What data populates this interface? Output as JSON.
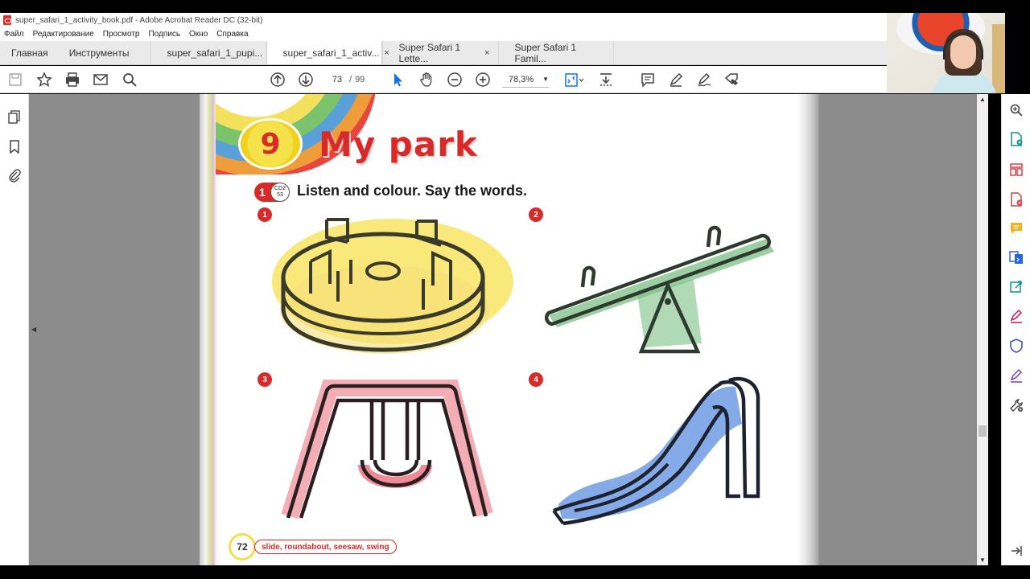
{
  "window": {
    "title": "super_safari_1_activity_book.pdf - Adobe Acrobat Reader DC (32-bit)"
  },
  "menu": [
    "Файл",
    "Редактирование",
    "Просмотр",
    "Подпись",
    "Окно",
    "Справка"
  ],
  "tabs": {
    "home": "Главная",
    "tools": "Инструменты",
    "documents": [
      {
        "label": "super_safari_1_pupi...",
        "active": false,
        "closable": false
      },
      {
        "label": "super_safari_1_activ...",
        "active": true,
        "closable": true
      },
      {
        "label": "Super Safari 1 Lette...",
        "active": false,
        "closable": true
      },
      {
        "label": "Super Safari 1 Famil...",
        "active": false,
        "closable": false
      }
    ],
    "close_glyph": "×"
  },
  "toolbar": {
    "current_page": "73",
    "page_separator": "/",
    "total_pages": "99",
    "zoom": "78,3%",
    "icons": [
      "save-icon",
      "star-icon",
      "print-icon",
      "email-icon",
      "search-icon",
      "page-up-icon",
      "page-down-icon",
      "select-cursor-icon",
      "hand-icon",
      "zoom-out-icon",
      "zoom-in-icon",
      "fit-page-icon",
      "scroll-mode-icon",
      "comment-icon",
      "highlight-pen-icon",
      "sign-icon",
      "fill-sign-icon"
    ]
  },
  "left_nav": {
    "icons": [
      "page-thumbnails-icon",
      "bookmark-icon",
      "attachment-icon"
    ]
  },
  "right_tools": {
    "icons": [
      "zoom-tool-icon",
      "create-pdf-icon",
      "organize-pages-icon",
      "export-pdf-icon",
      "comment-tool-icon",
      "convert-icon",
      "share-icon",
      "fill-sign-tool-icon",
      "protect-icon",
      "edit-pdf-icon",
      "more-tools-icon"
    ]
  },
  "page": {
    "unit_number": "9",
    "unit_title": "My park",
    "activity_number": "1",
    "cd_label_top": "CD2",
    "cd_label_bottom": "53",
    "instruction": "Listen and colour. Say the words.",
    "pictures": [
      {
        "number": "1",
        "item": "roundabout",
        "color": "#f7e35a"
      },
      {
        "number": "2",
        "item": "seesaw",
        "color": "#7cbf86"
      },
      {
        "number": "3",
        "item": "swing",
        "color": "#f08a94"
      },
      {
        "number": "4",
        "item": "slide",
        "color": "#5b8fe0"
      }
    ],
    "page_number": "72",
    "footer_words": "slide, roundabout, seesaw, swing"
  },
  "colors": {
    "accent_red": "#d92a2a",
    "badge_yellow": "#f2df47",
    "doc_background": "#8c8c8c"
  }
}
